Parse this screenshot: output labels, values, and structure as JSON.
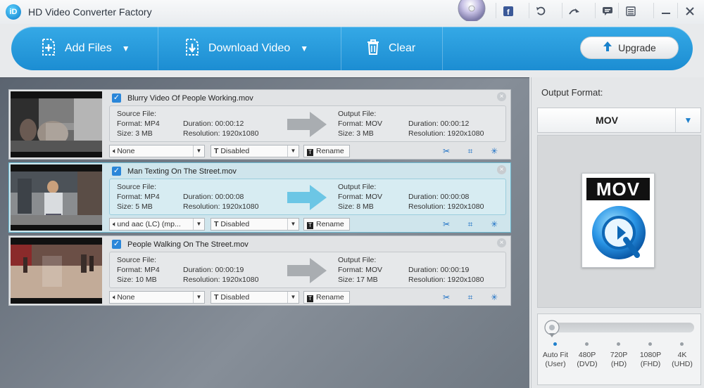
{
  "app": {
    "logo_text": "iD",
    "title": "HD Video Converter Factory"
  },
  "titlebar_icons": [
    "disc-icon",
    "facebook-icon",
    "undo-icon",
    "redo-icon",
    "chat-icon",
    "menu-icon",
    "minimize-icon",
    "close-icon"
  ],
  "toolbar": {
    "add_files": "Add Files",
    "download_video": "Download Video",
    "clear": "Clear",
    "upgrade": "Upgrade",
    "accent_color": "#2a9ce0"
  },
  "files": [
    {
      "name": "Blurry Video Of People Working.mov",
      "source_label": "Source File:",
      "src_format": "Format: MP4",
      "src_size": "Size: 3 MB",
      "src_duration": "Duration: 00:00:12",
      "src_resolution": "Resolution: 1920x1080",
      "output_label": "Output File:",
      "out_format": "Format: MOV",
      "out_size": "Size: 3 MB",
      "out_duration": "Duration: 00:00:12",
      "out_resolution": "Resolution: 1920x1080",
      "audio": "None",
      "subtitle": "Disabled",
      "rename": "Rename",
      "selected": false
    },
    {
      "name": "Man Texting On The Street.mov",
      "source_label": "Source File:",
      "src_format": "Format: MP4",
      "src_size": "Size: 5 MB",
      "src_duration": "Duration: 00:00:08",
      "src_resolution": "Resolution: 1920x1080",
      "output_label": "Output File:",
      "out_format": "Format: MOV",
      "out_size": "Size: 8 MB",
      "out_duration": "Duration: 00:00:08",
      "out_resolution": "Resolution: 1920x1080",
      "audio": "und aac (LC) (mp...",
      "subtitle": "Disabled",
      "rename": "Rename",
      "selected": true
    },
    {
      "name": "People Walking On The Street.mov",
      "source_label": "Source File:",
      "src_format": "Format: MP4",
      "src_size": "Size: 10 MB",
      "src_duration": "Duration: 00:00:19",
      "src_resolution": "Resolution: 1920x1080",
      "output_label": "Output File:",
      "out_format": "Format: MOV",
      "out_size": "Size: 17 MB",
      "out_duration": "Duration: 00:00:19",
      "out_resolution": "Resolution: 1920x1080",
      "audio": "None",
      "subtitle": "Disabled",
      "rename": "Rename",
      "selected": false
    }
  ],
  "output": {
    "label": "Output Format:",
    "format": "MOV",
    "icon_text": "MOV",
    "resolutions": [
      {
        "line1": "Auto Fit",
        "line2": "(User)",
        "active": true
      },
      {
        "line1": "480P",
        "line2": "(DVD)",
        "active": false
      },
      {
        "line1": "720P",
        "line2": "(HD)",
        "active": false
      },
      {
        "line1": "1080P",
        "line2": "(FHD)",
        "active": false
      },
      {
        "line1": "4K",
        "line2": "(UHD)",
        "active": false
      }
    ]
  }
}
